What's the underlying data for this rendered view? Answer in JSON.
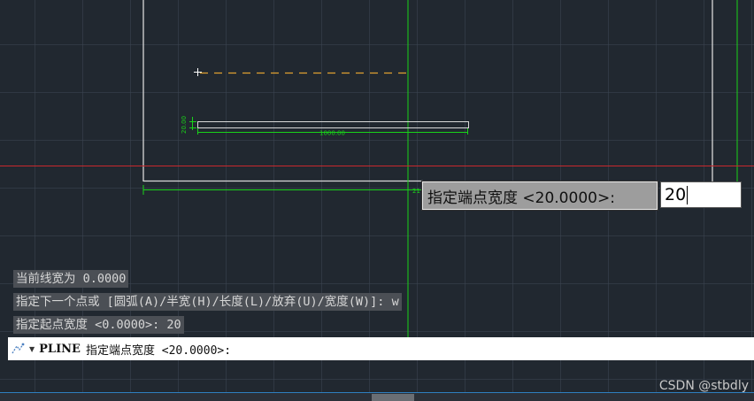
{
  "history": [
    {
      "text": "当前线宽为 0.0000"
    },
    {
      "text": "指定下一个点或 [圆弧(A)/半宽(H)/长度(L)/放弃(U)/宽度(W)]: w"
    },
    {
      "text": "指定起点宽度 <0.0000>: 20"
    }
  ],
  "command_line": {
    "command": "PLINE",
    "prompt": "指定端点宽度 <20.0000>:"
  },
  "dynamic_input": {
    "prompt": "指定端点宽度 <20.0000>:",
    "value": "20"
  },
  "drawing": {
    "dim_width": "1000.00",
    "dim_height": "20.00",
    "dim_partial": "21"
  },
  "watermark": "CSDN @stbdly",
  "colors": {
    "background": "#212830",
    "crosshair": "#c8282d",
    "dimension": "#19d219",
    "geometry": "#d8d8d8",
    "rubber_band": "#e0a030"
  }
}
